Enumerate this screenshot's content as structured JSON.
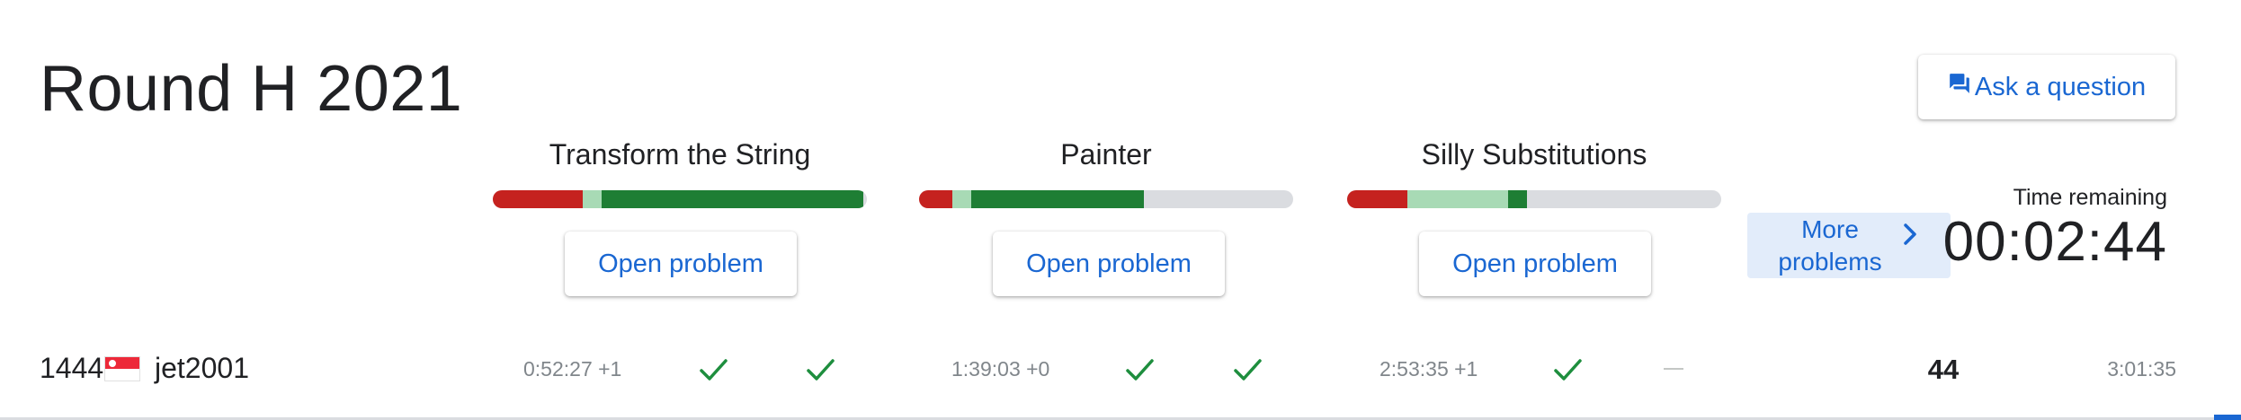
{
  "round": {
    "title": "Round H 2021"
  },
  "header": {
    "ask_label": "Ask a question"
  },
  "problems": [
    {
      "name": "Transform the String",
      "open_label": "Open problem",
      "progress": {
        "wrong": 0.24,
        "pending": 0.05,
        "correct": 0.7
      }
    },
    {
      "name": "Painter",
      "open_label": "Open problem",
      "progress": {
        "wrong": 0.09,
        "pending": 0.05,
        "correct": 0.46
      }
    },
    {
      "name": "Silly Substitutions",
      "open_label": "Open problem",
      "progress": {
        "wrong": 0.16,
        "pending": 0.27,
        "correct": 0.05
      }
    }
  ],
  "more": {
    "line1": "More",
    "line2": "problems"
  },
  "timer": {
    "label": "Time remaining",
    "value": "00:02:44"
  },
  "scoreboard": {
    "rank": "1444",
    "country": "Singapore",
    "user": "jet2001",
    "cells": [
      {
        "time": "0:52:27 +1",
        "small": "solved",
        "large": "solved"
      },
      {
        "time": "1:39:03 +0",
        "small": "solved",
        "large": "solved"
      },
      {
        "time": "2:53:35 +1",
        "small": "solved",
        "large": "not-attempted"
      }
    ],
    "score": "44",
    "penalty": "3:01:35"
  },
  "colors": {
    "accent": "#1a67d2",
    "wrong": "#c5221f",
    "pending": "#a8dab5",
    "correct": "#1e7e34",
    "unattempted": "#dadce0",
    "check": "#1e8e3e"
  }
}
